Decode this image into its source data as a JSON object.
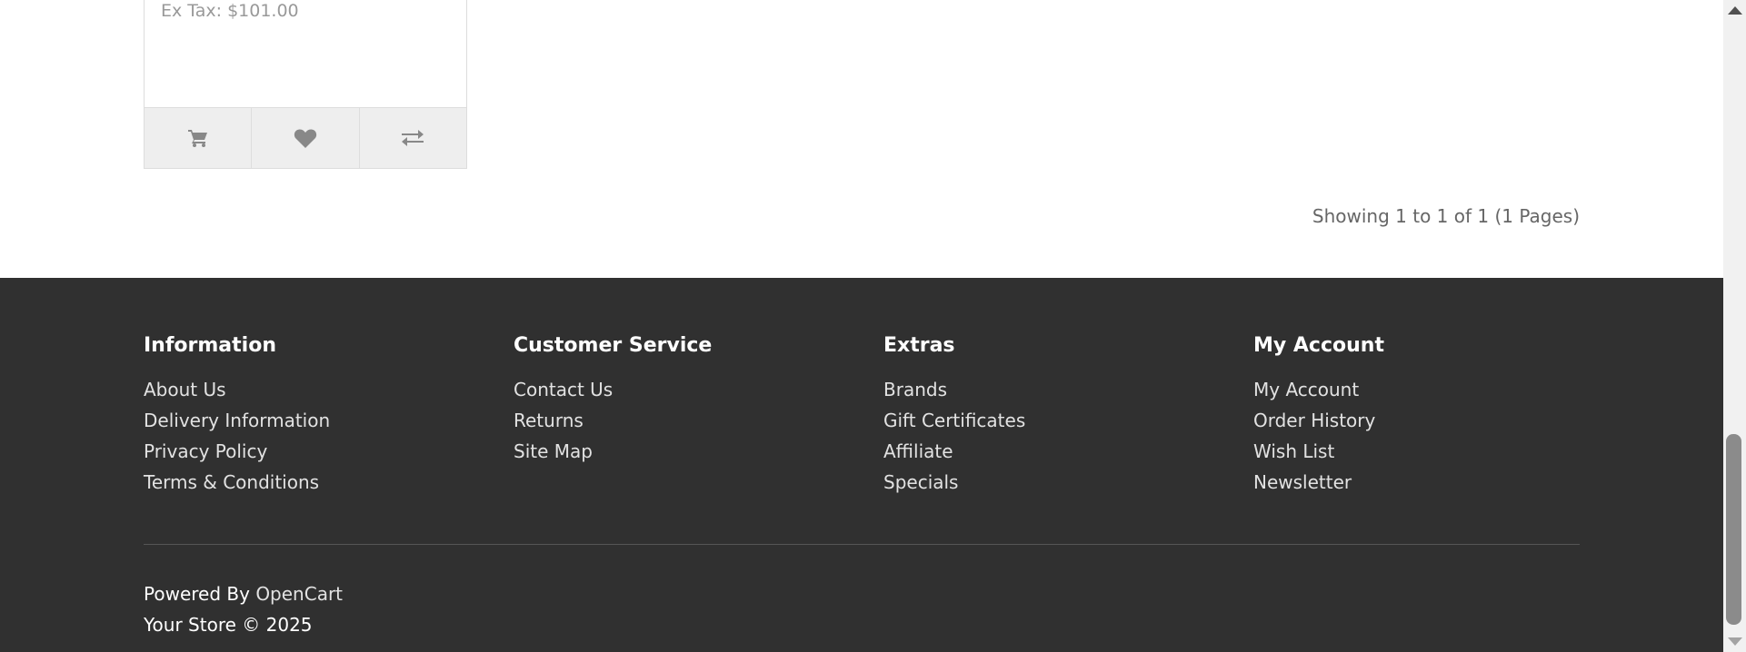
{
  "product": {
    "price_ex_tax": "Ex Tax: $101.00",
    "buttons": [
      {
        "name": "add-to-cart-button",
        "icon": "cart-icon"
      },
      {
        "name": "add-to-wishlist-button",
        "icon": "heart-icon"
      },
      {
        "name": "compare-button",
        "icon": "exchange-icon"
      }
    ],
    "icon_color": "#888888"
  },
  "pagination": {
    "results": "Showing 1 to 1 of 1 (1 Pages)"
  },
  "footer": {
    "background": "#303030",
    "columns": [
      {
        "title": "Information",
        "links": [
          "About Us",
          "Delivery Information",
          "Privacy Policy",
          "Terms & Conditions"
        ]
      },
      {
        "title": "Customer Service",
        "links": [
          "Contact Us",
          "Returns",
          "Site Map"
        ]
      },
      {
        "title": "Extras",
        "links": [
          "Brands",
          "Gift Certificates",
          "Affiliate",
          "Specials"
        ]
      },
      {
        "title": "My Account",
        "links": [
          "My Account",
          "Order History",
          "Wish List",
          "Newsletter"
        ]
      }
    ],
    "powered_by_prefix": "Powered By",
    "powered_by_link": "OpenCart",
    "copyright": "Your Store © 2025"
  }
}
